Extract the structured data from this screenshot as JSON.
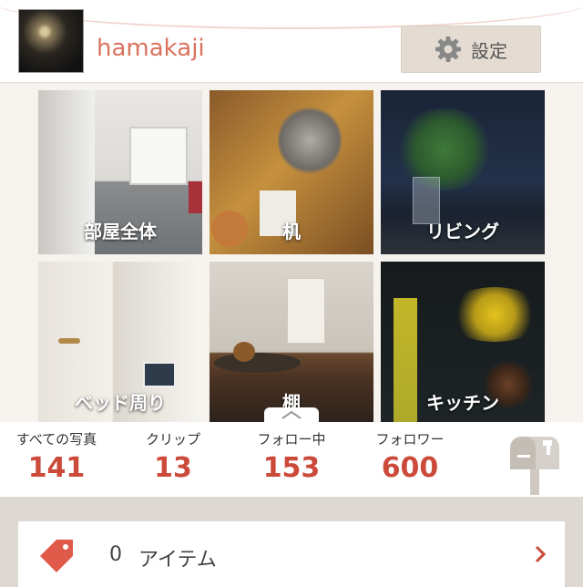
{
  "header": {
    "username": "hamakaji",
    "settings_label": "設定"
  },
  "tiles": [
    {
      "label": "部屋全体"
    },
    {
      "label": "机"
    },
    {
      "label": "リビング"
    },
    {
      "label": "ベッド周り"
    },
    {
      "label": "棚"
    },
    {
      "label": "キッチン"
    }
  ],
  "stats": [
    {
      "label": "すべての写真",
      "value": "141"
    },
    {
      "label": "クリップ",
      "value": "13"
    },
    {
      "label": "フォロー中",
      "value": "153"
    },
    {
      "label": "フォロワー",
      "value": "600"
    }
  ],
  "items": {
    "count": "0",
    "label": "アイテム"
  },
  "colors": {
    "accent": "#cc4a3a",
    "username": "#d9735e",
    "background": "#ddd8d2"
  },
  "icons": [
    "gear-icon",
    "mailbox-icon",
    "tag-icon",
    "chevron-right-icon",
    "chevron-up-icon"
  ]
}
